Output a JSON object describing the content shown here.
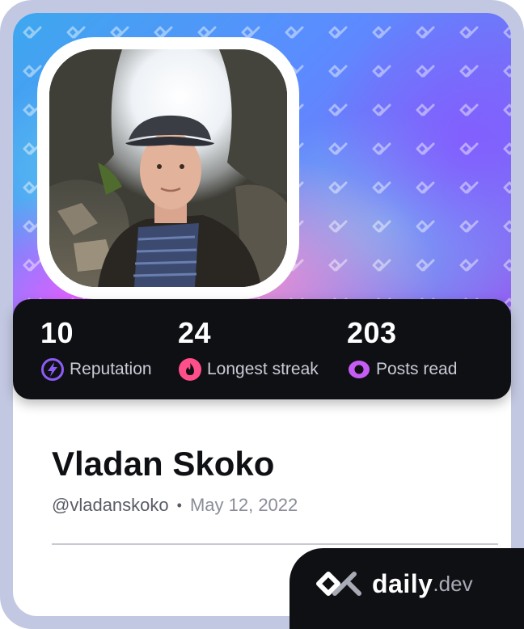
{
  "profile": {
    "name": "Vladan Skoko",
    "handle": "@vladanskoko",
    "separator": "•",
    "joined_date": "May 12, 2022"
  },
  "stats": [
    {
      "value": "10",
      "label": "Reputation",
      "icon": "lightning-icon",
      "color": "#8b5cf6"
    },
    {
      "value": "24",
      "label": "Longest streak",
      "icon": "flame-icon",
      "color": "#ff4f8b"
    },
    {
      "value": "203",
      "label": "Posts read",
      "icon": "eye-icon",
      "color": "#c75cf5"
    }
  ],
  "brand": {
    "name": "daily",
    "tld": ".dev",
    "logo_icon": "daily-dev-logo-icon"
  },
  "colors": {
    "card_bg": "#0f1014",
    "frame": "#c3c8e2",
    "accent_purple": "#8b5cf6",
    "accent_pink": "#ff4f8b",
    "accent_magenta": "#c75cf5"
  }
}
